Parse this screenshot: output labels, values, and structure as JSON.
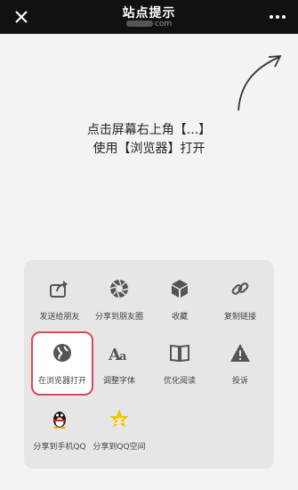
{
  "topbar": {
    "title": "站点提示",
    "domain_suffix": "com",
    "close_icon": "close-icon",
    "more_icon": "more-dots-icon"
  },
  "hint": {
    "line1": "点击屏幕右上角【...】",
    "line2": "使用【浏览器】打开"
  },
  "share_menu": {
    "row1": [
      {
        "label": "发送给朋友",
        "icon": "share-arrow-icon"
      },
      {
        "label": "分享到朋友圈",
        "icon": "moments-icon"
      },
      {
        "label": "收藏",
        "icon": "cube-icon"
      },
      {
        "label": "复制链接",
        "icon": "link-icon"
      }
    ],
    "row2": [
      {
        "label": "在浏览器打开",
        "icon": "globe-icon"
      },
      {
        "label": "调整字体",
        "icon": "font-icon"
      },
      {
        "label": "优化阅读",
        "icon": "book-icon"
      },
      {
        "label": "投诉",
        "icon": "warning-icon"
      }
    ],
    "row3": [
      {
        "label": "分享到手机QQ",
        "icon": "qq-penguin-icon"
      },
      {
        "label": "分享到QQ空间",
        "icon": "qzone-star-icon"
      }
    ]
  },
  "colors": {
    "highlight": "#d9475a",
    "topbar": "#111111",
    "icon": "#555555"
  }
}
